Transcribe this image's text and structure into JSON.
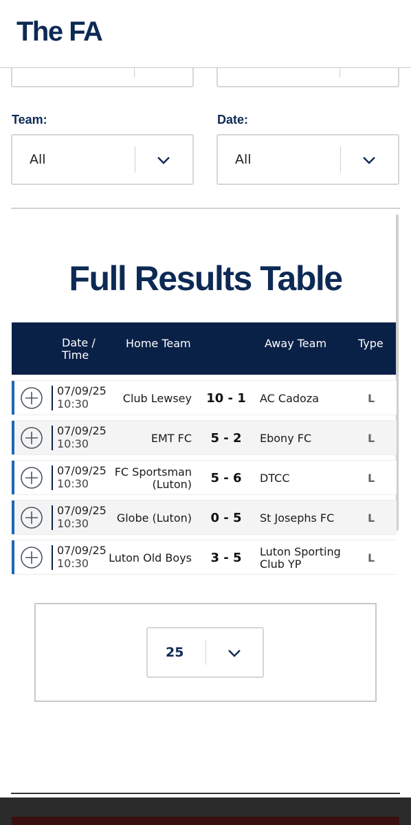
{
  "header": {
    "logo_text": "The FA"
  },
  "filters": {
    "team": {
      "label": "Team:",
      "value": "All"
    },
    "date": {
      "label": "Date:",
      "value": "All"
    }
  },
  "results": {
    "title": "Full Results Table",
    "columns": {
      "date_time": "Date / Time",
      "home": "Home Team",
      "away": "Away Team",
      "type": "Type"
    },
    "rows": [
      {
        "date": "07/09/25",
        "time": "10:30",
        "home": "Club Lewsey",
        "score": "10 - 1",
        "away": "AC Cadoza",
        "type": "L"
      },
      {
        "date": "07/09/25",
        "time": "10:30",
        "home": "EMT FC",
        "score": "5 - 2",
        "away": "Ebony FC",
        "type": "L"
      },
      {
        "date": "07/09/25",
        "time": "10:30",
        "home": "FC Sportsman (Luton)",
        "score": "5 - 6",
        "away": "DTCC",
        "type": "L"
      },
      {
        "date": "07/09/25",
        "time": "10:30",
        "home": "Globe (Luton)",
        "score": "0 - 5",
        "away": "St Josephs FC",
        "type": "L"
      },
      {
        "date": "07/09/25",
        "time": "10:30",
        "home": "Luton Old Boys",
        "score": "3 - 5",
        "away": "Luton Sporting Club YP",
        "type": "L"
      }
    ]
  },
  "pagination": {
    "page_size": "25"
  },
  "colors": {
    "navy": "#0d2a55",
    "table_header": "#0a2147",
    "accent": "#1c68b4"
  },
  "icons": {
    "expand": "plus-circle-icon",
    "dropdown": "chevron-down-icon"
  }
}
